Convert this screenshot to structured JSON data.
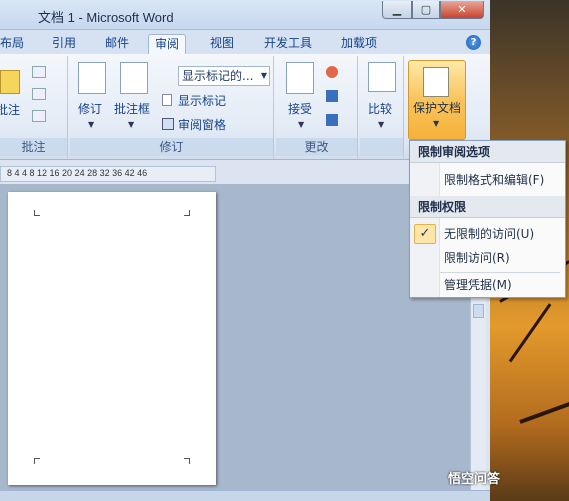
{
  "window": {
    "title": "文档 1 - Microsoft Word"
  },
  "tabs": [
    "布局",
    "引用",
    "邮件",
    "审阅",
    "视图",
    "开发工具",
    "加载项"
  ],
  "active_tab": "审阅",
  "ribbon": {
    "comments_group": {
      "new_comment": "批注",
      "label": "批注"
    },
    "tracking_group": {
      "track_changes": "修订",
      "balloons": "批注框",
      "display_combo": "显示标记的...",
      "show_markup": "显示标记",
      "reviewing_pane": "审阅窗格",
      "label": "修订"
    },
    "changes_group": {
      "accept": "接受",
      "label": "更改"
    },
    "compare_group": {
      "compare": "比较"
    },
    "protect_group": {
      "protect": "保护文档"
    }
  },
  "ruler": {
    "ticks": "8  4    4   8  12  16  20  24  28  32  36   42  46"
  },
  "menu": {
    "section1_header": "限制审阅选项",
    "item_restrict_format": "限制格式和编辑(F)",
    "section2_header": "限制权限",
    "item_unrestricted": "无限制的访问(U)",
    "item_restricted": "限制访问(R)",
    "item_manage": "管理凭据(M)"
  },
  "watermark": "悟空问答"
}
